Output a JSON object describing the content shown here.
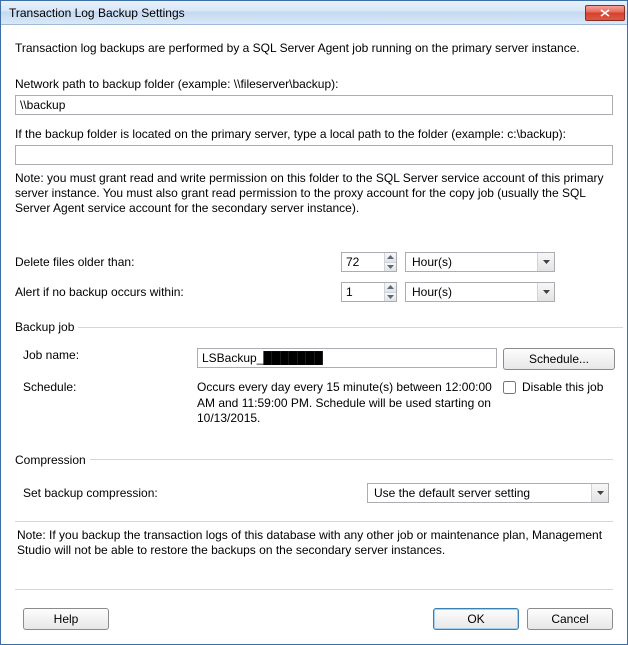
{
  "window": {
    "title": "Transaction Log Backup Settings"
  },
  "intro": "Transaction log backups are performed by a SQL Server Agent job running on the primary server instance.",
  "networkPath": {
    "label": "Network path to backup folder (example: \\\\fileserver\\backup):",
    "value": "\\\\backup"
  },
  "localPath": {
    "label": "If the backup folder is located on the primary server, type a local path to the folder (example: c:\\backup):",
    "value": ""
  },
  "permissionNote": "Note: you must grant read and write permission on this folder to the SQL Server service account of this primary server instance. You must also grant read permission to the proxy account for the copy job (usually the SQL Server Agent service account for the secondary server instance).",
  "deleteOlder": {
    "label": "Delete files older than:",
    "value": "72",
    "unit": "Hour(s)"
  },
  "alertNoBackup": {
    "label": "Alert if no backup occurs within:",
    "value": "1",
    "unit": "Hour(s)"
  },
  "backupJob": {
    "legend": "Backup job",
    "jobNameLabel": "Job name:",
    "jobName": "LSBackup_███████",
    "scheduleButton": "Schedule...",
    "scheduleLabel": "Schedule:",
    "scheduleText": "Occurs every day every 15 minute(s) between 12:00:00 AM and 11:59:00 PM. Schedule will be used starting on 10/13/2015.",
    "disableLabel": "Disable this job",
    "disableChecked": false
  },
  "compression": {
    "legend": "Compression",
    "label": "Set backup compression:",
    "value": "Use the default server setting"
  },
  "footnote": "Note: If you backup the transaction logs of this database with any other job or maintenance plan, Management Studio will not be able to restore the backups on the secondary server instances.",
  "buttons": {
    "help": "Help",
    "ok": "OK",
    "cancel": "Cancel"
  }
}
